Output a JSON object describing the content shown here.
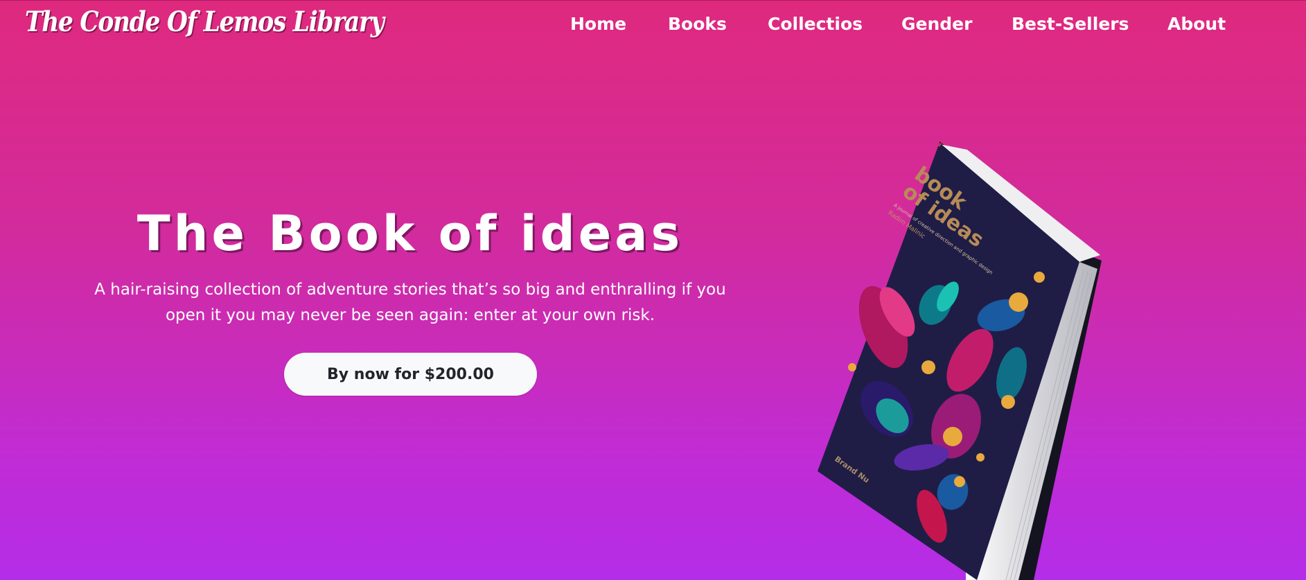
{
  "header": {
    "logo_text": "The Conde Of Lemos Library"
  },
  "nav": {
    "items": [
      "Home",
      "Books",
      "Collectios",
      "Gender",
      "Best-Sellers",
      "About"
    ]
  },
  "hero": {
    "title": "The Book of ideas",
    "description": "A hair-raising collection of adventure stories that’s so big and enthralling if you open it you may never be seen again: enter at your own risk.",
    "button_label": "By now for $200.00"
  },
  "book_cover": {
    "title_line1": "book",
    "title_line2": "of ideas",
    "subtitle": "A journal of creative direction and graphic design",
    "author": "Radim Malinic",
    "publisher": "Brand Nu"
  },
  "colors": {
    "background_top": "#df297e",
    "background_bottom": "#b42de8",
    "button_bg": "#f8f9fa",
    "button_text": "#212529",
    "book_cover": "#1f1d45",
    "book_title": "#b78b58"
  }
}
